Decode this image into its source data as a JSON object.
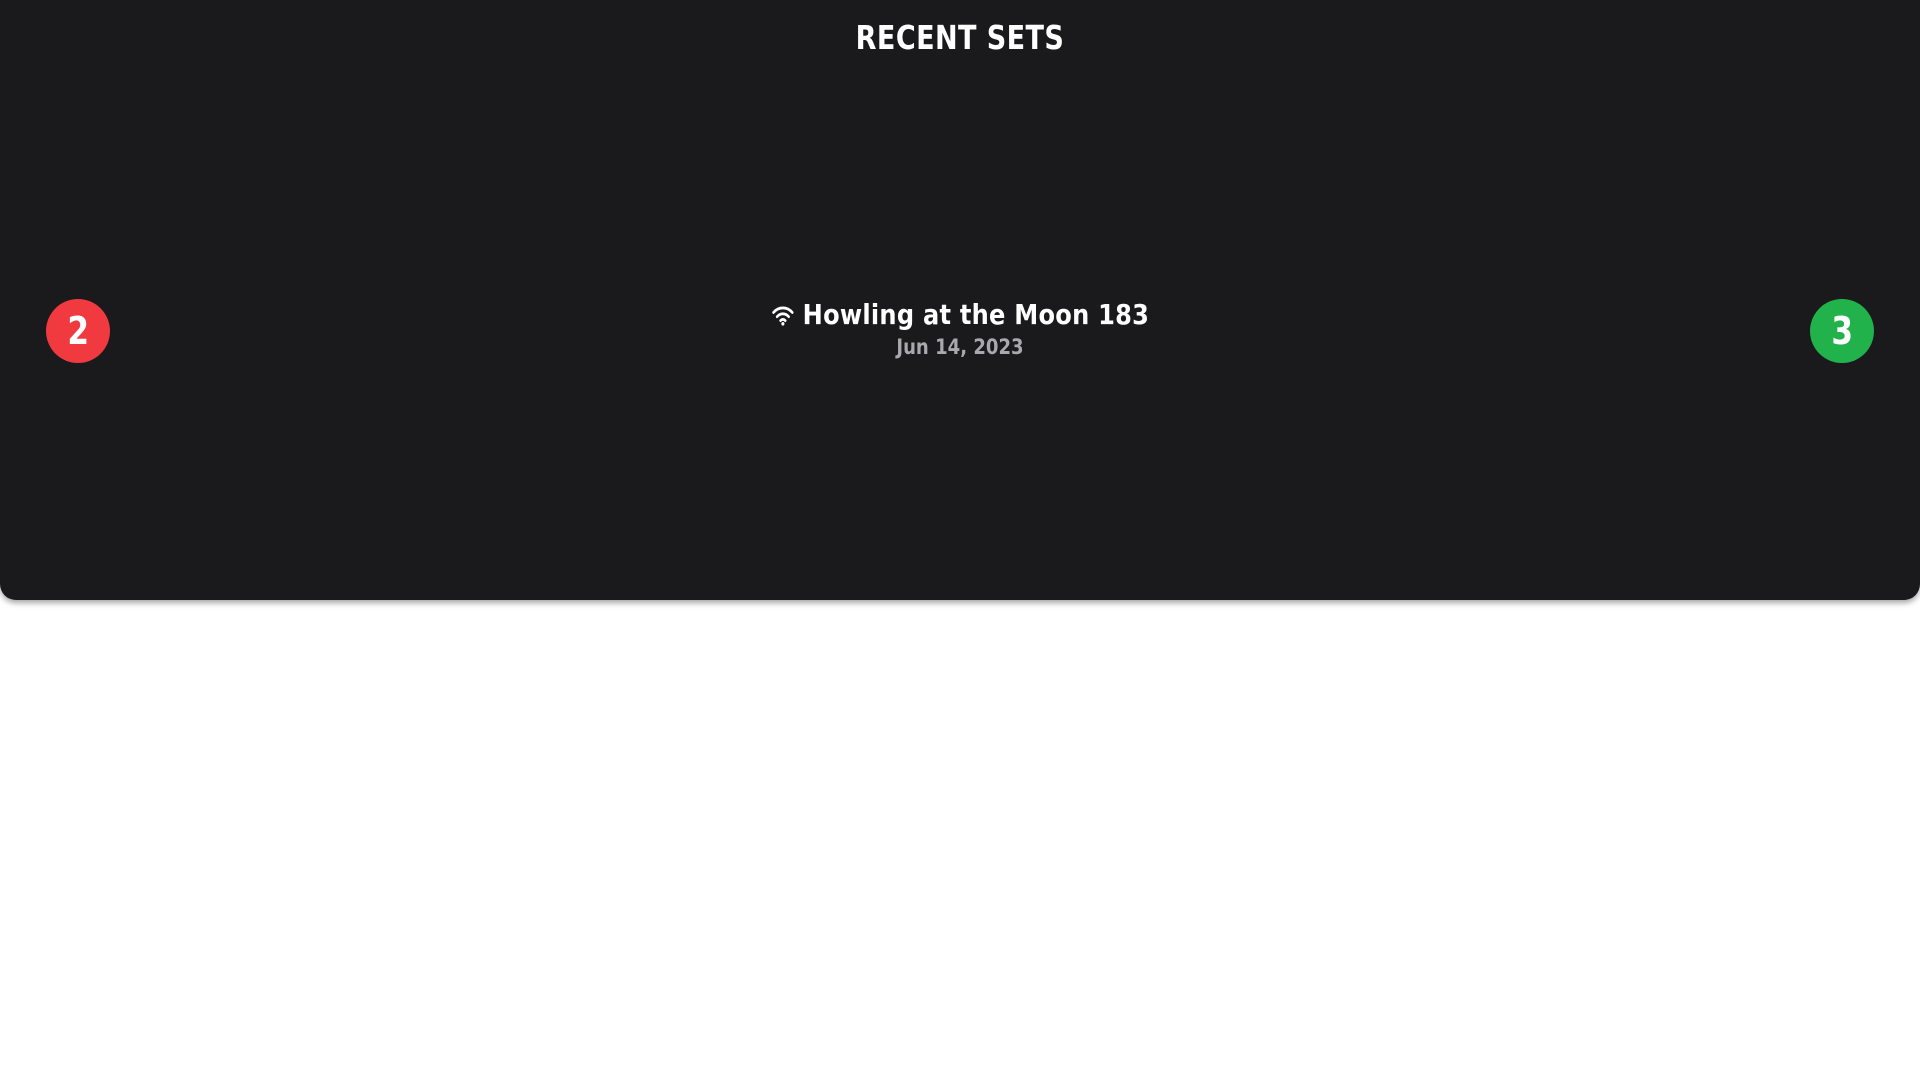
{
  "panel": {
    "title": "RECENT SETS"
  },
  "navigation": {
    "previous_label": "2",
    "previous_color": "#f03a3f",
    "next_label": "3",
    "next_color": "#22b24c"
  },
  "current_set": {
    "icon": "wifi-icon",
    "title": "Howling at the Moon 183",
    "date": "Jun 14, 2023"
  }
}
